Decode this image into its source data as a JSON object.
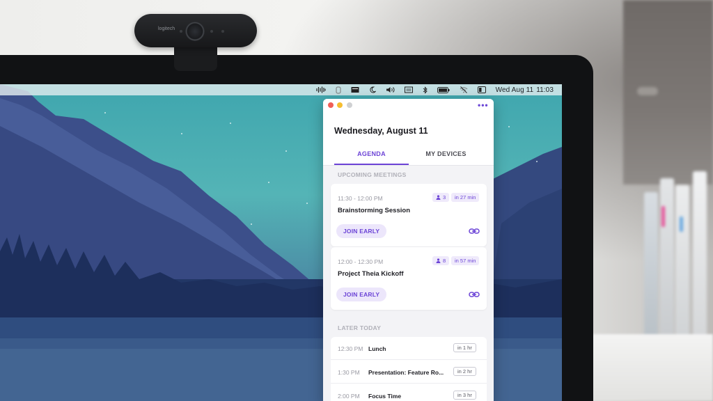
{
  "webcam": {
    "brand": "logitech"
  },
  "menubar": {
    "icons": [
      "audio-waveform-icon",
      "clipboard-icon",
      "display-icon",
      "moon-icon",
      "volume-icon",
      "keyboard-icon",
      "bluetooth-icon",
      "battery-icon",
      "wifi-off-icon",
      "control-center-icon"
    ],
    "date": "Wed Aug 11",
    "time": "11:03"
  },
  "app": {
    "date_heading": "Wednesday, August 11",
    "more_label": "•••",
    "tabs": [
      {
        "label": "AGENDA",
        "active": true
      },
      {
        "label": "MY DEVICES",
        "active": false
      }
    ],
    "upcoming_label": "UPCOMING MEETINGS",
    "meetings": [
      {
        "time": "11:30 - 12:00 PM",
        "title": "Brainstorming Session",
        "attendees": "3",
        "starts_in": "in 27 min",
        "join_label": "JOIN EARLY"
      },
      {
        "time": "12:00 - 12:30 PM",
        "title": "Project Theia Kickoff",
        "attendees": "8",
        "starts_in": "in 57 min",
        "join_label": "JOIN EARLY"
      }
    ],
    "later_label": "LATER TODAY",
    "later_items": [
      {
        "time": "12:30 PM",
        "title": "Lunch",
        "badge": "in 1 hr"
      },
      {
        "time": "1:30 PM",
        "title": "Presentation: Feature Ro...",
        "badge": "in 2 hr"
      },
      {
        "time": "2:00 PM",
        "title": "Focus Time",
        "badge": "in 3 hr"
      }
    ],
    "colors": {
      "accent": "#6b43d6",
      "accent_soft": "#ece6fb"
    }
  }
}
